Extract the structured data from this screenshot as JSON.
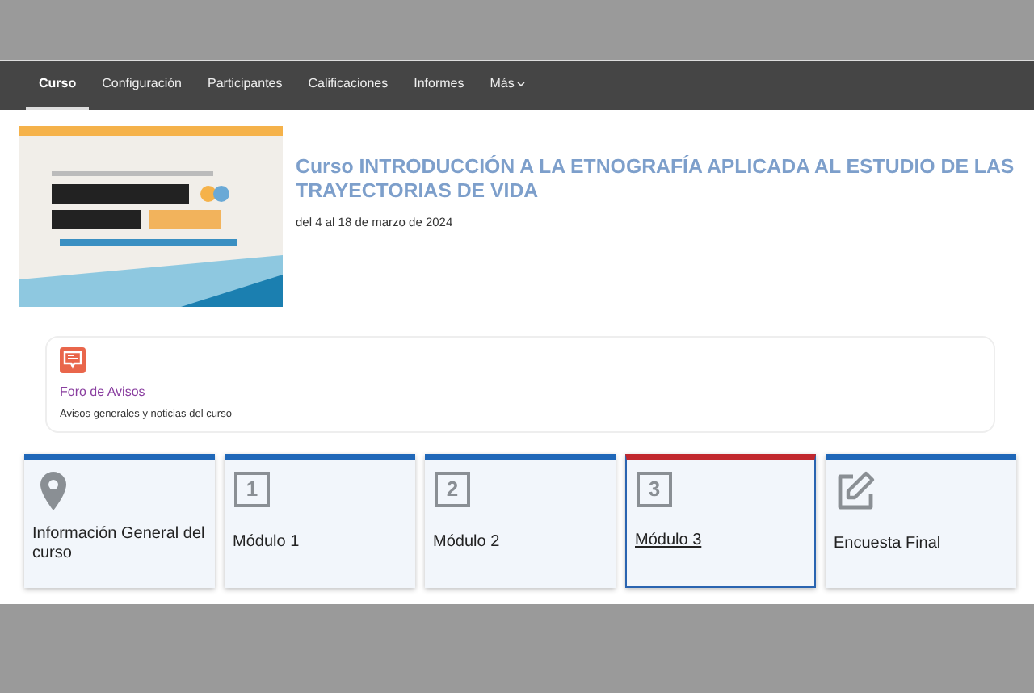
{
  "nav": [
    {
      "label": "Curso",
      "selected": true
    },
    {
      "label": "Configuración",
      "selected": false
    },
    {
      "label": "Participantes",
      "selected": false
    },
    {
      "label": "Calificaciones",
      "selected": false
    },
    {
      "label": "Informes",
      "selected": false
    },
    {
      "label": "Más",
      "selected": false,
      "kind": "dropdown"
    }
  ],
  "header": {
    "title": "Curso INTRODUCCIÓN A LA ETNOGRAFÍA APLICADA AL ESTUDIO DE LAS TRAYECTORIAS DE VIDA",
    "dates": "del 4 al 18 de marzo de 2024"
  },
  "forum": {
    "title": "Foro de Avisos",
    "description": "Avisos generales y noticias del curso"
  },
  "tiles": [
    {
      "label": "Información General del curso",
      "kind": "pin",
      "selected": false
    },
    {
      "label": "Módulo 1",
      "kind": "number",
      "number": "1",
      "selected": false
    },
    {
      "label": "Módulo 2",
      "kind": "number",
      "number": "2",
      "selected": false
    },
    {
      "label": "Módulo 3",
      "kind": "number",
      "number": "3",
      "selected": true
    },
    {
      "label": "Encuesta Final",
      "kind": "edit",
      "selected": false
    }
  ]
}
